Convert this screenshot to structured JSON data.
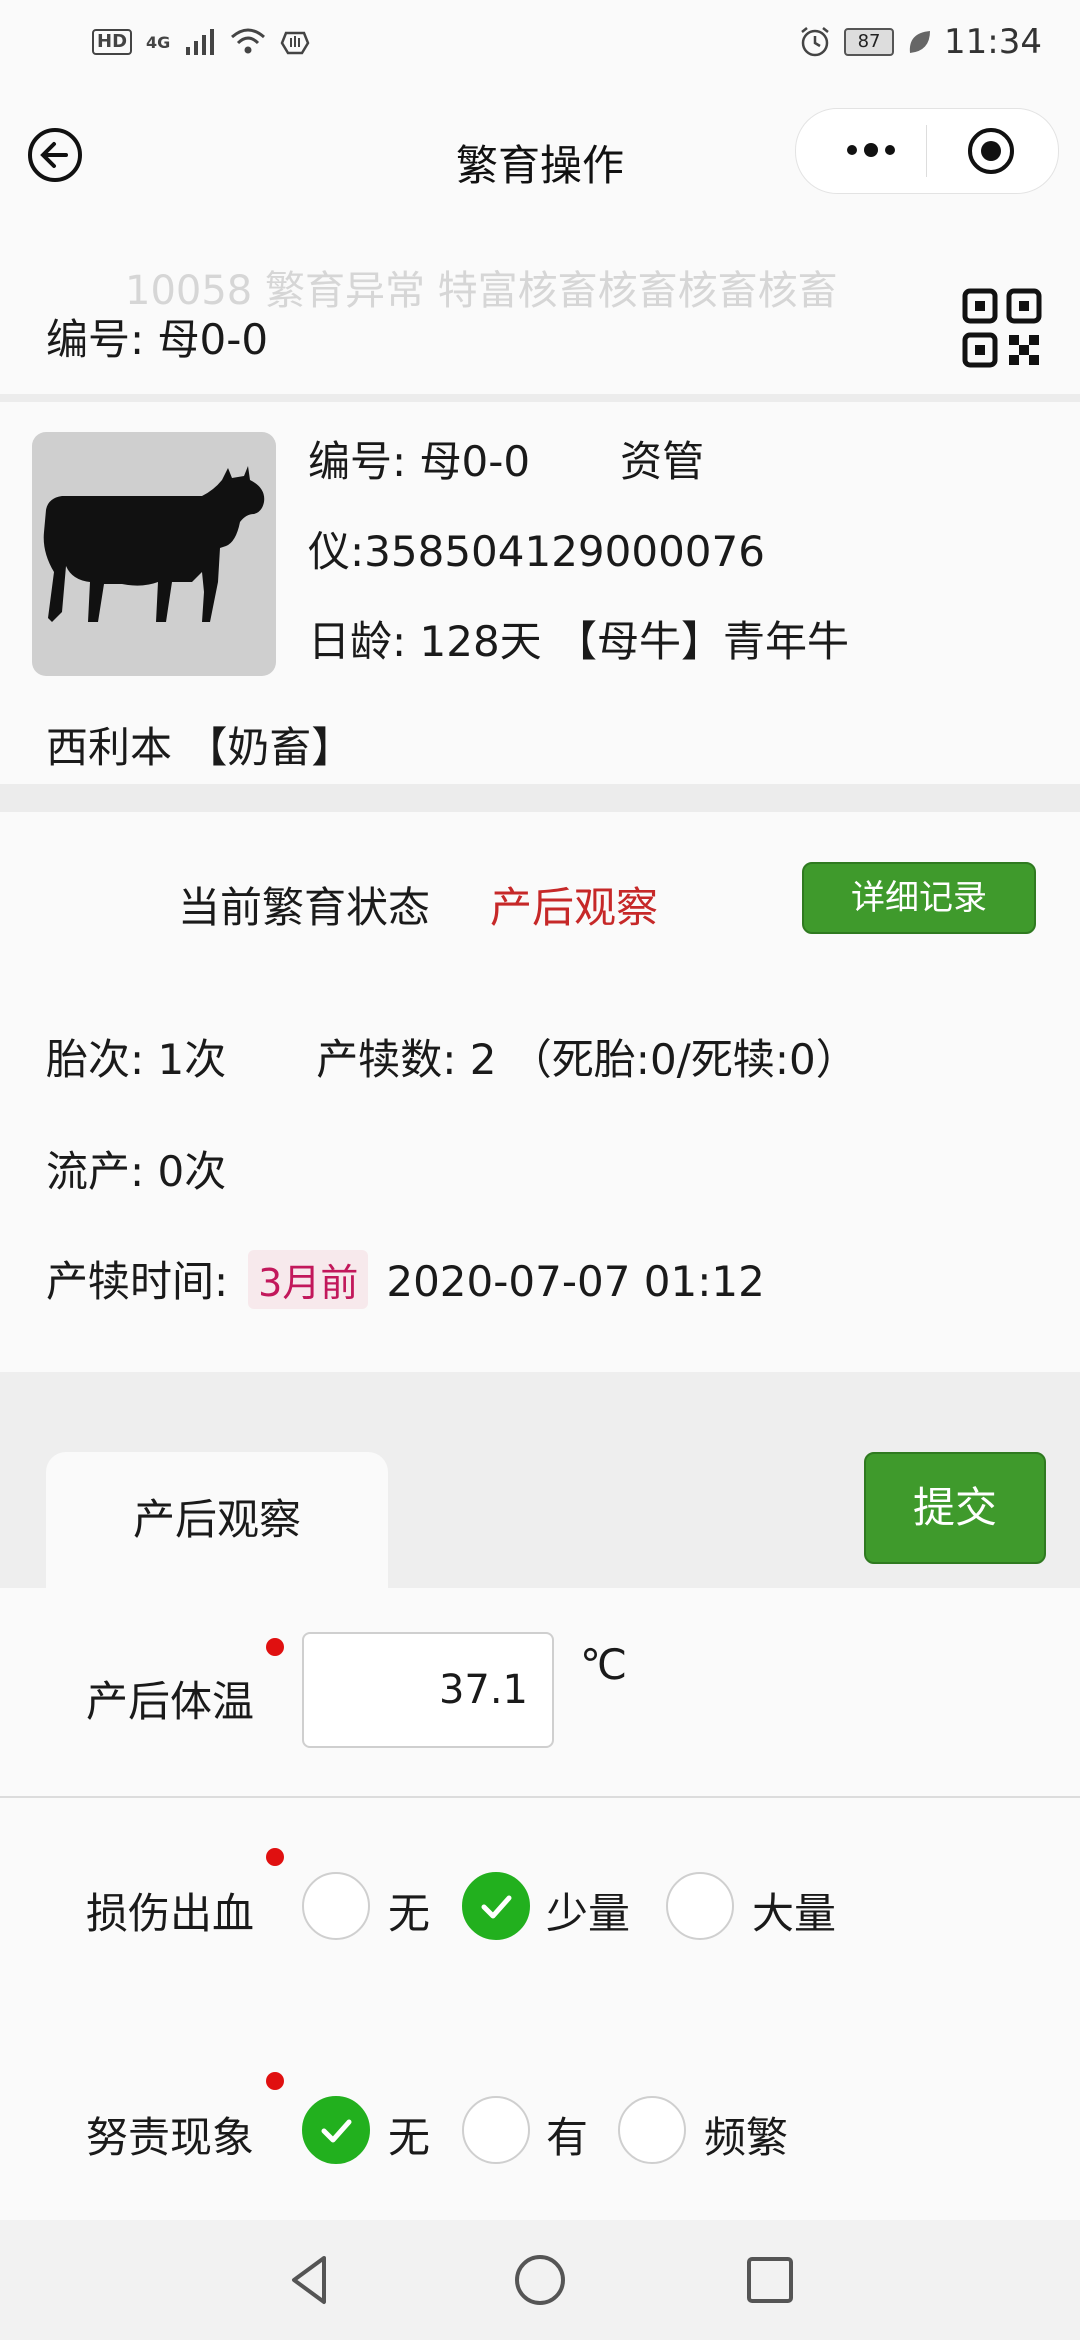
{
  "status_bar": {
    "hd": "HD",
    "network": "4G",
    "battery": "87",
    "time": "11:34"
  },
  "nav": {
    "title": "繁育操作"
  },
  "id_strip": {
    "marquee": "10058  繁育异常  特富核畜核畜核畜核畜",
    "label": "编号: 母0-0"
  },
  "animal": {
    "line1a": "编号: 母0-0",
    "line1b": "资管",
    "line2": "仪:358504129000076",
    "line3": "日龄: 128天 【母牛】青年牛",
    "breed": "西利本 【奶畜】"
  },
  "breeding": {
    "status_label": "当前繁育状态",
    "status_value": "产后观察",
    "detail_button": "详细记录",
    "parity": "胎次: 1次",
    "calves": "产犊数: 2 （死胎:0/死犊:0）",
    "abortion": "流产: 0次",
    "calving_time_label": "产犊时间:",
    "calving_relative": "3月前",
    "calving_time": "2020-07-07 01:12"
  },
  "tab": {
    "label": "产后观察",
    "submit": "提交"
  },
  "form": {
    "temperature": {
      "label": "产后体温",
      "value": "37.1",
      "unit": "℃"
    },
    "bleeding": {
      "label": "损伤出血",
      "options": [
        "无",
        "少量",
        "大量"
      ],
      "selected": "少量"
    },
    "straining": {
      "label": "努责现象",
      "options": [
        "无",
        "有",
        "频繁"
      ],
      "selected": "无"
    }
  },
  "colors": {
    "accent_green": "#3f9a2c",
    "status_red": "#c62828",
    "radio_green": "#22b01e"
  }
}
